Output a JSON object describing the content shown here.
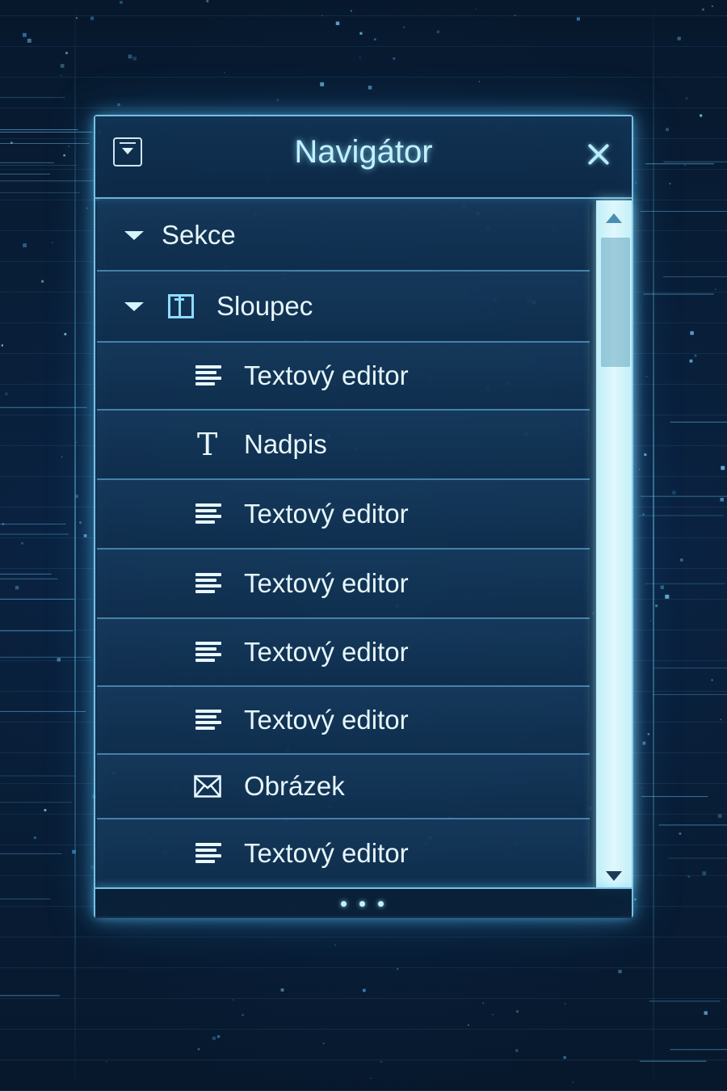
{
  "panel": {
    "title": "Navigátor",
    "collapse_icon": "collapse-panel-icon",
    "close_icon": "close-icon",
    "footer_handle_icon": "resize-handle-icon"
  },
  "tree": {
    "items": [
      {
        "label": "Sekce",
        "icon": "caret-down-icon",
        "expanded": true
      },
      {
        "label": "Sloupec",
        "icon": "column-icon",
        "expanded": true
      },
      {
        "label": "Textový editor",
        "icon": "text-editor-icon"
      },
      {
        "label": "Nadpis",
        "icon": "heading-icon"
      },
      {
        "label": "Textový editor",
        "icon": "text-editor-icon"
      },
      {
        "label": "Textový editor",
        "icon": "text-editor-icon"
      },
      {
        "label": "Textový editor",
        "icon": "text-editor-icon"
      },
      {
        "label": "Textový editor",
        "icon": "text-editor-icon"
      },
      {
        "label": "Obrázek",
        "icon": "image-icon"
      },
      {
        "label": "Textový editor",
        "icon": "text-editor-icon"
      }
    ]
  },
  "colors": {
    "accent_glow": "#8fdcff",
    "panel_bg": "#0c2642",
    "text": "#e6f6fb",
    "title": "#bff2ff"
  }
}
